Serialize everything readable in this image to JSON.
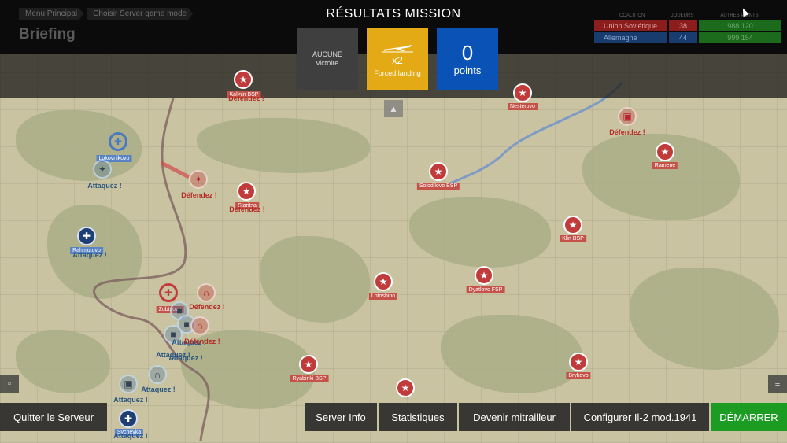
{
  "breadcrumbs": [
    "Menu Principal",
    "Choisir Server game mode"
  ],
  "page_title": "Briefing",
  "results": {
    "title": "RÉSULTATS MISSION",
    "victory_line1": "AUCUNE",
    "victory_line2": "victoire",
    "landing_multiplier": "x2",
    "landing_label": "Forced landing",
    "points_value": "0",
    "points_label": "points"
  },
  "score": {
    "headers": [
      "COALITION",
      "JOUEURS",
      "AUTRES POINTS"
    ],
    "rows": [
      {
        "team": "Union Soviétique",
        "players": "38",
        "points": "988 120",
        "team_color": "#8c1d1d",
        "players_color": "#8c1d1d",
        "points_color": "#1c6b1c"
      },
      {
        "team": "Allemagne",
        "players": "44",
        "points": "999 154",
        "team_color": "#173c6d",
        "players_color": "#173c6d",
        "points_color": "#1c6b1c"
      }
    ]
  },
  "map": {
    "places": [
      "Lokovnikovo",
      "Rahmutovo",
      "Zubtsovo",
      "Sychevka",
      "Staritsa",
      "Solodilovo BSP",
      "Lotoshino",
      "Dyatlovo FSP",
      "Klin BSP",
      "Nesterovo",
      "Ramene",
      "Ryabinki BSP",
      "Brykovo",
      "Kalinin BSP"
    ],
    "tasks": {
      "attack": "Attaquez !",
      "defend": "Défendez !"
    }
  },
  "buttons": {
    "quit": "Quitter le Serveur",
    "server_info": "Server Info",
    "stats": "Statistiques",
    "gunner": "Devenir mitrailleur",
    "configure": "Configurer Il-2 mod.1941",
    "start": "DÉMARRER"
  },
  "icons": {
    "collapse": "chevron-up-icon",
    "chat": "chat-icon",
    "log": "log-icon"
  },
  "colors": {
    "soviet": "#c23b3b",
    "german": "#1f3f74",
    "start": "#1c9c22",
    "landing_tile": "#e3aa16",
    "points_tile": "#0a52b6"
  }
}
